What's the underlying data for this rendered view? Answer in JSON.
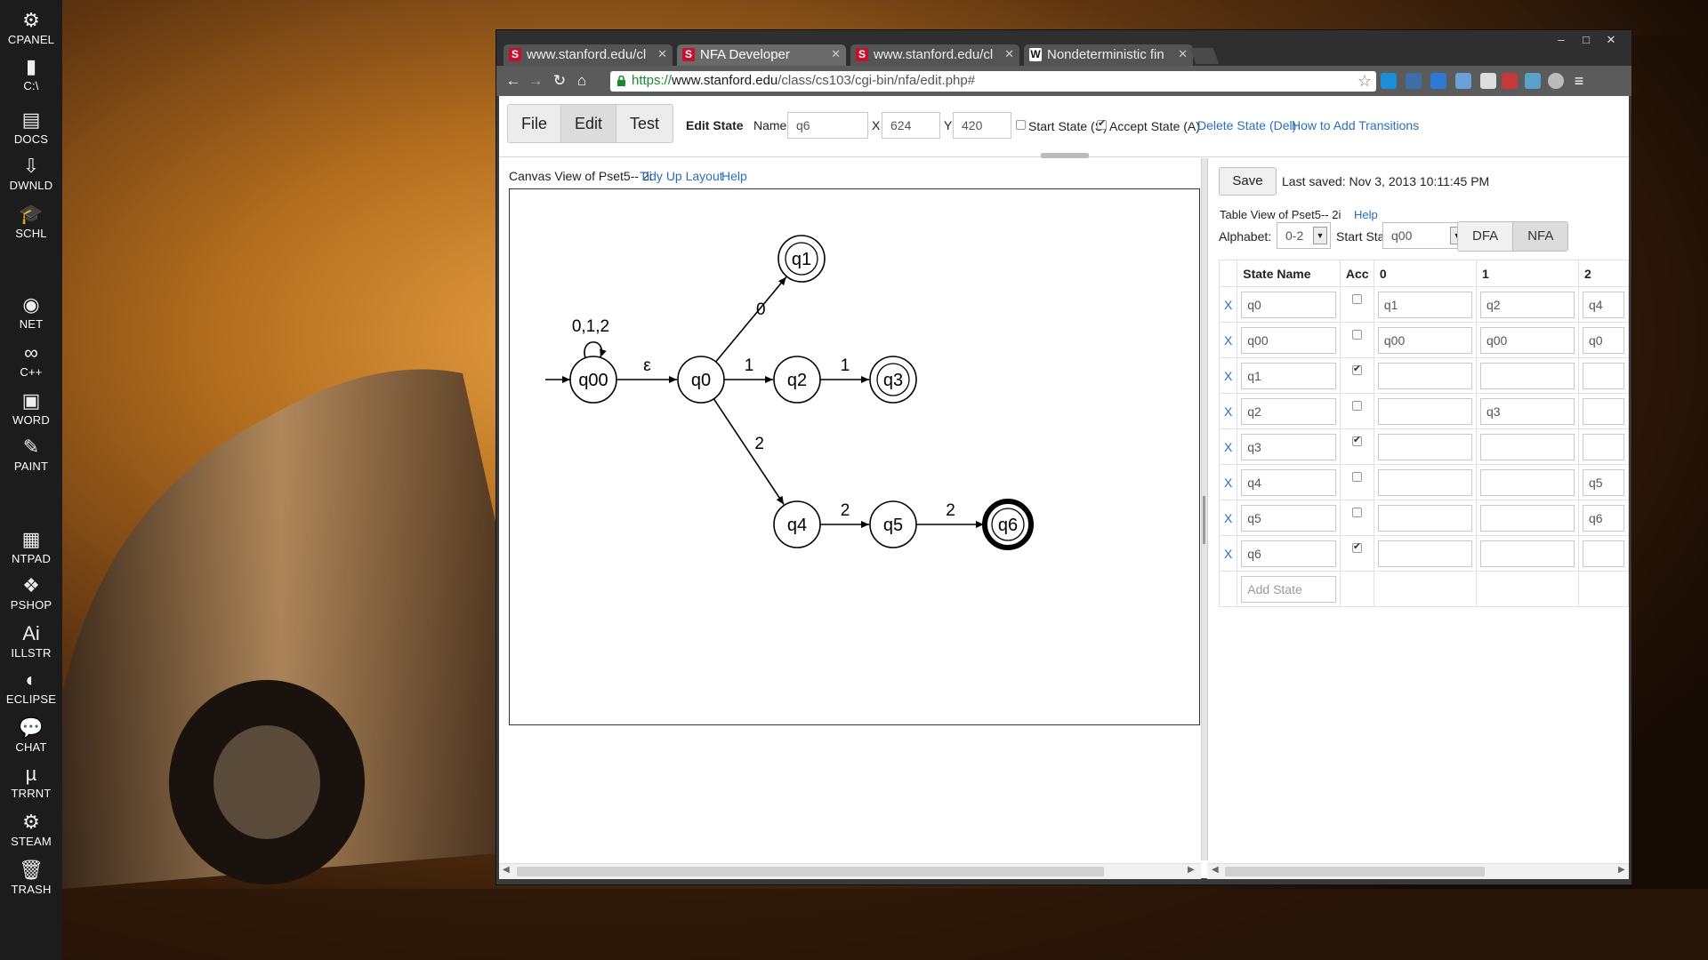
{
  "dock": [
    {
      "name": "dock-cpanel",
      "label": "CPANEL",
      "glyph": "⚙"
    },
    {
      "name": "dock-c-drive",
      "label": "C:\\",
      "glyph": "▮"
    },
    {
      "name": "dock-docs",
      "label": "DOCS",
      "glyph": "▤"
    },
    {
      "name": "dock-dwnld",
      "label": "DWNLD",
      "glyph": "⇩"
    },
    {
      "name": "dock-schl",
      "label": "SCHL",
      "glyph": "🎓"
    },
    {
      "name": "dock-net",
      "label": "NET",
      "glyph": "◉"
    },
    {
      "name": "dock-cpp",
      "label": "C++",
      "glyph": "∞"
    },
    {
      "name": "dock-word",
      "label": "WORD",
      "glyph": "▣"
    },
    {
      "name": "dock-paint",
      "label": "PAINT",
      "glyph": "✎"
    },
    {
      "name": "dock-ntpad",
      "label": "NTPAD",
      "glyph": "▦"
    },
    {
      "name": "dock-pshop",
      "label": "PSHOP",
      "glyph": "❖"
    },
    {
      "name": "dock-illstr",
      "label": "ILLSTR",
      "glyph": "Ai"
    },
    {
      "name": "dock-eclipse",
      "label": "ECLIPSE",
      "glyph": "◐"
    },
    {
      "name": "dock-chat",
      "label": "CHAT",
      "glyph": "💬"
    },
    {
      "name": "dock-trrnt",
      "label": "TRRNT",
      "glyph": "µ"
    },
    {
      "name": "dock-steam",
      "label": "STEAM",
      "glyph": "⚙"
    },
    {
      "name": "dock-trash",
      "label": "TRASH",
      "glyph": "🗑"
    }
  ],
  "browser": {
    "tabs": [
      {
        "title": "www.stanford.edu/cl",
        "icon": "stanford-icon",
        "active": false
      },
      {
        "title": "NFA Developer",
        "icon": "stanford-icon",
        "active": true
      },
      {
        "title": "www.stanford.edu/cl",
        "icon": "stanford-icon",
        "active": false
      },
      {
        "title": "Nondeterministic fin",
        "icon": "wikipedia-icon",
        "active": false
      }
    ],
    "url": {
      "scheme": "https://",
      "host": "www.stanford.edu",
      "path": "/class/cs103/cgi-bin/nfa/edit.php#"
    }
  },
  "app": {
    "modes": [
      "File",
      "Edit",
      "Test"
    ],
    "active_mode": "Edit",
    "edit_state": {
      "heading": "Edit State",
      "name_label": "Name",
      "name_value": "q6",
      "x_label": "X",
      "x_value": "624",
      "y_label": "Y",
      "y_value": "420",
      "start_label": "Start State (S)",
      "start_checked": false,
      "accept_label": "Accept State (A)",
      "accept_checked": true,
      "delete_link": "Delete State (Del)",
      "howto_link": "How to Add Transitions"
    },
    "canvas": {
      "title": "Canvas View of Pset5-- 2i",
      "tidy_link": "Tidy Up Layout",
      "help_link": "Help",
      "states": [
        {
          "id": "q00",
          "accept": false,
          "start": true,
          "selected": false
        },
        {
          "id": "q0",
          "accept": false,
          "start": false,
          "selected": false
        },
        {
          "id": "q1",
          "accept": true,
          "start": false,
          "selected": false
        },
        {
          "id": "q2",
          "accept": false,
          "start": false,
          "selected": false
        },
        {
          "id": "q3",
          "accept": true,
          "start": false,
          "selected": false
        },
        {
          "id": "q4",
          "accept": false,
          "start": false,
          "selected": false
        },
        {
          "id": "q5",
          "accept": false,
          "start": false,
          "selected": false
        },
        {
          "id": "q6",
          "accept": true,
          "start": false,
          "selected": true
        }
      ],
      "transitions": [
        {
          "from": "q00",
          "to": "q00",
          "label": "0,1,2"
        },
        {
          "from": "q00",
          "to": "q0",
          "label": "ε"
        },
        {
          "from": "q0",
          "to": "q1",
          "label": "0"
        },
        {
          "from": "q0",
          "to": "q2",
          "label": "1"
        },
        {
          "from": "q2",
          "to": "q3",
          "label": "1"
        },
        {
          "from": "q0",
          "to": "q4",
          "label": "2"
        },
        {
          "from": "q4",
          "to": "q5",
          "label": "2"
        },
        {
          "from": "q5",
          "to": "q6",
          "label": "2"
        }
      ]
    },
    "table": {
      "save_label": "Save",
      "last_saved": "Last saved: Nov 3, 2013 10:11:45 PM",
      "title": "Table View of Pset5-- 2i",
      "help_link": "Help",
      "alphabet_label": "Alphabet:",
      "alphabet_value": "0-2",
      "start_label": "Start State:",
      "start_value": "q00",
      "dfa_label": "DFA",
      "nfa_label": "NFA",
      "active_type": "NFA",
      "headers": [
        "State Name",
        "Acc",
        "0",
        "1",
        "2"
      ],
      "rows": [
        {
          "name": "q0",
          "acc": false,
          "t0": "q1",
          "t1": "q2",
          "t2": "q4"
        },
        {
          "name": "q00",
          "acc": false,
          "t0": "q00",
          "t1": "q00",
          "t2": "q0"
        },
        {
          "name": "q1",
          "acc": true,
          "t0": "",
          "t1": "",
          "t2": ""
        },
        {
          "name": "q2",
          "acc": false,
          "t0": "",
          "t1": "q3",
          "t2": ""
        },
        {
          "name": "q3",
          "acc": true,
          "t0": "",
          "t1": "",
          "t2": ""
        },
        {
          "name": "q4",
          "acc": false,
          "t0": "",
          "t1": "",
          "t2": "q5"
        },
        {
          "name": "q5",
          "acc": false,
          "t0": "",
          "t1": "",
          "t2": "q6"
        },
        {
          "name": "q6",
          "acc": true,
          "t0": "",
          "t1": "",
          "t2": ""
        }
      ],
      "delete_mark": "X",
      "add_placeholder": "Add State"
    }
  }
}
